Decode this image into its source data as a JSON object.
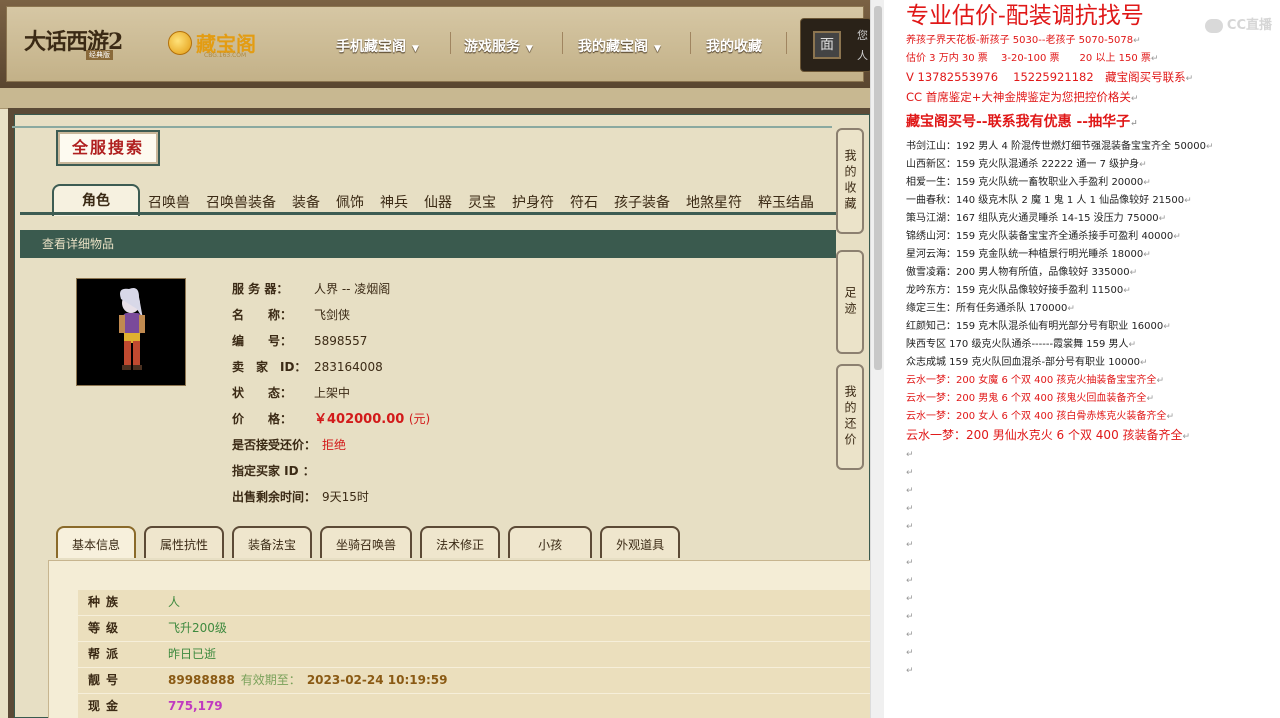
{
  "header": {
    "game_logo": "大话西游2",
    "game_logo_sub": "经典版",
    "cbg_logo": "藏宝阁",
    "cbg_url": "CBG.163.COM",
    "nav": [
      "手机藏宝阁",
      "游戏服务",
      "我的藏宝阁",
      "我的收藏"
    ],
    "user_line1": "您",
    "user_line2": "人"
  },
  "search": {
    "title": "全服搜索"
  },
  "category_tabs": [
    "角色",
    "召唤兽",
    "召唤兽装备",
    "装备",
    "佩饰",
    "神兵",
    "仙器",
    "灵宝",
    "护身符",
    "符石",
    "孩子装备",
    "地煞星符",
    "粹玉结晶"
  ],
  "detail_bar": "查看详细物品",
  "item": {
    "fields": [
      {
        "label": "服 务 器：",
        "value": "人界 -- 凌烟阁"
      },
      {
        "label": "名　　称：",
        "value": "飞剑侠"
      },
      {
        "label": "编　　号：",
        "value": "5898557"
      },
      {
        "label": "卖　家　ID：",
        "value": "283164008"
      },
      {
        "label": "状　　态：",
        "value": "上架中"
      },
      {
        "label": "价　　格：",
        "value": "￥402000.00",
        "unit": "(元)"
      },
      {
        "label": "是否接受还价：",
        "value": "拒绝"
      },
      {
        "label": "指定买家 ID ：",
        "value": ""
      },
      {
        "label": "出售剩余时间：",
        "value": "9天15时"
      }
    ]
  },
  "side_buttons": [
    "我的收藏",
    "足迹",
    "我的还价"
  ],
  "sub_tabs": [
    "基本信息",
    "属性抗性",
    "装备法宝",
    "坐骑召唤兽",
    "法术修正",
    "小孩",
    "外观道具"
  ],
  "info": {
    "rows": [
      {
        "label": "种族",
        "value": "人"
      },
      {
        "label": "等级",
        "value": "飞升200级"
      },
      {
        "label": "帮派",
        "value": "昨日已逝"
      },
      {
        "label": "靓号",
        "value": "89988888",
        "extra_label": "有效期至：",
        "extra_value": "2023-02-24 10:19:59"
      },
      {
        "label": "现金",
        "value": "775,179"
      }
    ]
  },
  "notes": {
    "title": "专业估价-配装调抗找号",
    "lines_top": [
      "养孩子界天花板-新孩子 5030--老孩子 5070-5078",
      "估价 3 万内 30 票　 3-20-100 票　　20 以上 150 票"
    ],
    "contact": "V 13782553976　 15225921182　藏宝阁买号联系",
    "appraise": "CC 首席鉴定+大神金牌鉴定为您把控价格关",
    "heading": "藏宝阁买号--联系我有优惠 --抽华子",
    "listings": [
      "书剑江山：192 男人 4 阶混传世燃灯细节强混装备宝宝齐全 50000",
      "山西新区：159 克火队混通杀 22222 通一 7 级护身",
      "相爱一生：159 克火队统一畜牧职业入手盈利 20000",
      "一曲春秋：140 级克木队 2 魔 1 鬼 1 人 1 仙品像较好 21500",
      "策马江湖：167 组队克火通灵睡杀 14-15 没压力 75000",
      "锦绣山河：159 克火队装备宝宝齐全通杀接手可盈利 40000",
      "星河云海：159 克金队统一种植景行明光睡杀 18000",
      "傲雪凌霜：200 男人物有所值，品像较好 335000",
      "龙吟东方：159 克火队品像较好接手盈利 11500",
      "缘定三生：所有任务通杀队 170000",
      "红颜知己：159 克木队混杀仙有明光部分号有职业 16000",
      "陕西专区 170 级克火队通杀------霞裳舞 159 男人",
      "众志成城 159 克火队回血混杀-部分号有职业 10000"
    ],
    "red_listings": [
      "云水一梦：200 女魔 6 个双 400 孩克火抽装备宝宝齐全",
      "云水一梦：200 男鬼 6 个双 400 孩鬼火回血装备齐全",
      "云水一梦：200 女人 6 个双 400 孩白骨赤炼克火装备齐全",
      "云水一梦：200 男仙水克火 6 个双 400 孩装备齐全"
    ],
    "para_mark": "↵",
    "empty_marks": 13,
    "watermark": "CC直播"
  }
}
